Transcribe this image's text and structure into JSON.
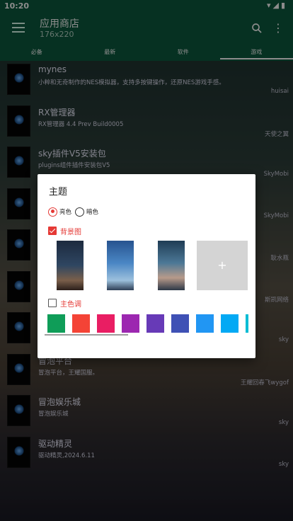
{
  "status": {
    "time": "10:20",
    "wifi_icon": "wifi-icon",
    "signal_icon": "signal-icon",
    "battery_icon": "battery-icon"
  },
  "appbar": {
    "title": "应用商店",
    "subtitle": "176x220"
  },
  "tabs": [
    {
      "label": "必备"
    },
    {
      "label": "最新"
    },
    {
      "label": "软件"
    },
    {
      "label": "游戏",
      "active": true
    }
  ],
  "items": [
    {
      "name": "mynes",
      "desc": "小粹和无奇制作的NES模拟器，支持多按键操作，还原NES游戏手感。",
      "author": "huisai"
    },
    {
      "name": "RX管理器",
      "desc": "RX管理器 4.4 Prev Build0005",
      "author": "天使之翼"
    },
    {
      "name": "sky插件V5安装包",
      "desc": "plugins组件插件安装包V5",
      "author": "SkyMobi"
    },
    {
      "name": "",
      "desc": "",
      "author": "SkyMobi"
    },
    {
      "name": "",
      "desc": "",
      "author": "耿水瓶"
    },
    {
      "name": "",
      "desc": "",
      "author": "斯凯网络"
    },
    {
      "name": "",
      "desc": "",
      "author": "sky"
    },
    {
      "name": "冒泡平台",
      "desc": "冒泡平台，王耀国服。",
      "author": "王耀回春飞wygof"
    },
    {
      "name": "冒泡娱乐城",
      "desc": "冒泡娱乐城",
      "author": "sky"
    },
    {
      "name": "驱动精灵",
      "desc": "驱动精灵,2024.6.11",
      "author": "sky"
    }
  ],
  "dialog": {
    "title": "主题",
    "radio_light": "亮色",
    "radio_dark": "暗色",
    "bg_label": "背景图",
    "add_symbol": "+",
    "primary_label": "主色调",
    "swatch_colors": [
      "#0f9d58",
      "#f44336",
      "#e91e63",
      "#9c27b0",
      "#673ab7",
      "#3f51b5",
      "#2196f3",
      "#03a9f4",
      "#00bcd4"
    ]
  }
}
